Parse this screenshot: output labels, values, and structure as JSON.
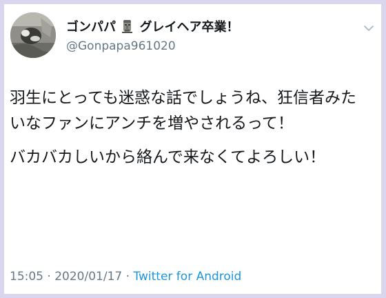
{
  "user": {
    "display_name_prefix": "ゴンパパ",
    "display_name_emoji": "moai-icon",
    "display_name_suffix": "グレイヘア卒業！",
    "handle": "@Gonpapa961020"
  },
  "tweet": {
    "paragraphs": [
      "羽生にとっても迷惑な話でしょうね、狂信者みたいなファンにアンチを増やされるって！",
      "バカバカしいから絡んで来なくてよろしい！"
    ],
    "time": "15:05",
    "separator": "·",
    "date": "2020/01/17",
    "source": "Twitter for Android"
  },
  "icons": {
    "menu": "chevron-down-icon"
  },
  "colors": {
    "frame": "#d9d6ee",
    "text": "#14171a",
    "secondary": "#657786",
    "link": "#1b95e0"
  }
}
